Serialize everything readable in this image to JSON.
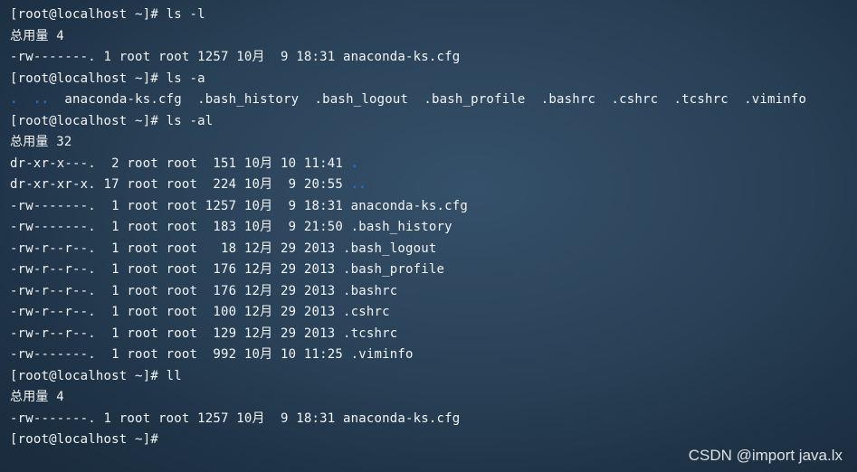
{
  "watermark": "CSDN @import java.lx",
  "lines": [
    [
      {
        "t": "[root@localhost ~]# ls -l"
      }
    ],
    [
      {
        "t": "总用量 4"
      }
    ],
    [
      {
        "t": "-rw-------. 1 root root 1257 10月  9 18:31 anaconda-ks.cfg"
      }
    ],
    [
      {
        "t": "[root@localhost ~]# ls -a"
      }
    ],
    [
      {
        "t": ".",
        "c": "dot"
      },
      {
        "t": "  "
      },
      {
        "t": "..",
        "c": "dot"
      },
      {
        "t": "  anaconda-ks.cfg  .bash_history  .bash_logout  .bash_profile  .bashrc  .cshrc  .tcshrc  .viminfo"
      }
    ],
    [
      {
        "t": "[root@localhost ~]# ls -al"
      }
    ],
    [
      {
        "t": "总用量 32"
      }
    ],
    [
      {
        "t": "dr-xr-x---.  2 root root  151 10月 10 11:41 "
      },
      {
        "t": ".",
        "c": "dot"
      }
    ],
    [
      {
        "t": "dr-xr-xr-x. 17 root root  224 10月  9 20:55 "
      },
      {
        "t": "..",
        "c": "dot"
      }
    ],
    [
      {
        "t": "-rw-------.  1 root root 1257 10月  9 18:31 anaconda-ks.cfg"
      }
    ],
    [
      {
        "t": "-rw-------.  1 root root  183 10月  9 21:50 .bash_history"
      }
    ],
    [
      {
        "t": "-rw-r--r--.  1 root root   18 12月 29 2013 .bash_logout"
      }
    ],
    [
      {
        "t": "-rw-r--r--.  1 root root  176 12月 29 2013 .bash_profile"
      }
    ],
    [
      {
        "t": "-rw-r--r--.  1 root root  176 12月 29 2013 .bashrc"
      }
    ],
    [
      {
        "t": "-rw-r--r--.  1 root root  100 12月 29 2013 .cshrc"
      }
    ],
    [
      {
        "t": "-rw-r--r--.  1 root root  129 12月 29 2013 .tcshrc"
      }
    ],
    [
      {
        "t": "-rw-------.  1 root root  992 10月 10 11:25 .viminfo"
      }
    ],
    [
      {
        "t": "[root@localhost ~]# ll"
      }
    ],
    [
      {
        "t": "总用量 4"
      }
    ],
    [
      {
        "t": "-rw-------. 1 root root 1257 10月  9 18:31 anaconda-ks.cfg"
      }
    ],
    [
      {
        "t": "[root@localhost ~]#"
      }
    ]
  ]
}
